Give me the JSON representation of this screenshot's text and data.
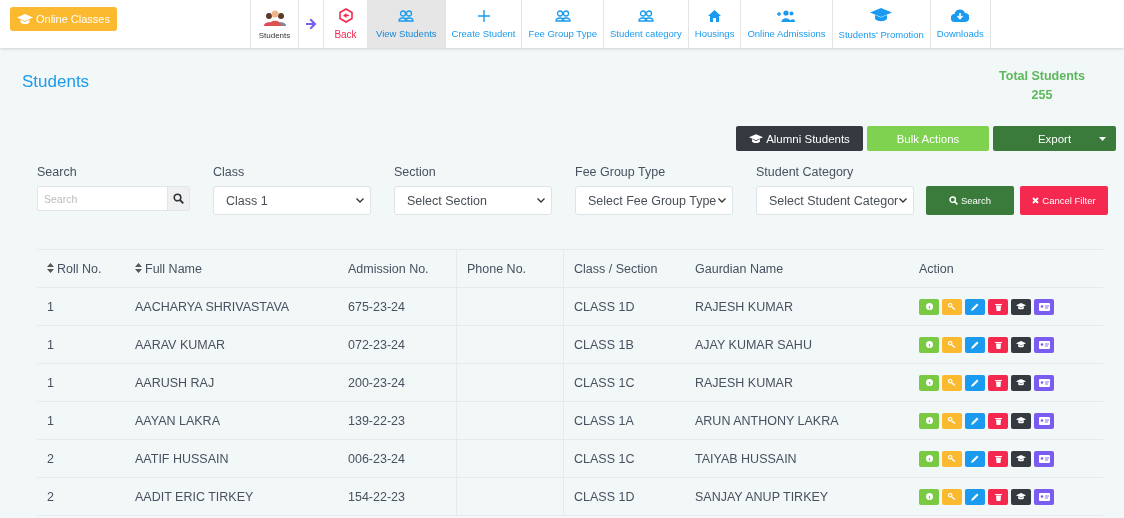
{
  "top_button": {
    "label": "Online Classes"
  },
  "nav": [
    {
      "kind": "module",
      "label": "Students",
      "selected": false
    },
    {
      "kind": "arrow"
    },
    {
      "kind": "back",
      "label": "Back",
      "selected": false
    },
    {
      "kind": "people",
      "label": "View Students",
      "selected": true
    },
    {
      "kind": "plus",
      "label": "Create Student",
      "selected": false
    },
    {
      "kind": "people",
      "label": "Fee Group Type",
      "selected": false
    },
    {
      "kind": "people",
      "label": "Student category",
      "selected": false
    },
    {
      "kind": "home",
      "label": "Housings",
      "selected": false
    },
    {
      "kind": "adduser",
      "label": "Online Admissions",
      "selected": false
    },
    {
      "kind": "cap",
      "label": "Students' Promotion",
      "selected": false
    },
    {
      "kind": "download",
      "label": "Downloads",
      "selected": false
    }
  ],
  "page_title": "Students",
  "total": {
    "label": "Total Students",
    "value": "255"
  },
  "actions": [
    {
      "kind": "alumni",
      "label": "Alumni Students"
    },
    {
      "kind": "bulk",
      "label": "Bulk Actions"
    },
    {
      "kind": "export",
      "label": "Export"
    }
  ],
  "filters": [
    {
      "kind": "search",
      "label": "Search",
      "placeholder": "Search"
    },
    {
      "kind": "select",
      "label": "Class",
      "value": "Class 1"
    },
    {
      "kind": "select",
      "label": "Section",
      "value": "Select Section"
    },
    {
      "kind": "select",
      "label": "Fee Group Type",
      "value": "Select Fee Group Type"
    },
    {
      "kind": "select",
      "label": "Student Category",
      "value": "Select Student Categor"
    }
  ],
  "filter_buttons": [
    {
      "kind": "search",
      "label": "Search"
    },
    {
      "kind": "cancel",
      "label": "Cancel Filter"
    }
  ],
  "table": {
    "columns": [
      {
        "label": "Roll No.",
        "sortable": true
      },
      {
        "label": "Full Name",
        "sortable": true
      },
      {
        "label": "Admission No.",
        "sortable": false
      },
      {
        "label": "Phone No.",
        "sortable": false
      },
      {
        "label": "Class / Section",
        "sortable": false
      },
      {
        "label": "Gaurdian Name",
        "sortable": false
      },
      {
        "label": "Action",
        "sortable": false
      }
    ],
    "row_actions": [
      {
        "kind": "info",
        "color": "#7ac943"
      },
      {
        "kind": "key",
        "color": "#fbb92f"
      },
      {
        "kind": "edit",
        "color": "#1a9bef"
      },
      {
        "kind": "delete",
        "color": "#f5284f"
      },
      {
        "kind": "graduate",
        "color": "#343a40"
      },
      {
        "kind": "card",
        "color": "#7b5cf0"
      }
    ],
    "rows": [
      {
        "roll": "1",
        "name": "AACHARYA SHRIVASTAVA",
        "admission": "675-23-24",
        "class": "CLASS 1D",
        "guardian": "RAJESH KUMAR"
      },
      {
        "roll": "1",
        "name": "AARAV KUMAR",
        "admission": "072-23-24",
        "class": "CLASS 1B",
        "guardian": "AJAY KUMAR SAHU"
      },
      {
        "roll": "1",
        "name": "AARUSH RAJ",
        "admission": "200-23-24",
        "class": "CLASS 1C",
        "guardian": "RAJESH KUMAR"
      },
      {
        "roll": "1",
        "name": "AAYAN LAKRA",
        "admission": "139-22-23",
        "class": "CLASS 1A",
        "guardian": "ARUN ANTHONY LAKRA"
      },
      {
        "roll": "2",
        "name": "AATIF HUSSAIN",
        "admission": "006-23-24",
        "class": "CLASS 1C",
        "guardian": "TAIYAB HUSSAIN"
      },
      {
        "roll": "2",
        "name": "AADIT ERIC TIRKEY",
        "admission": "154-22-23",
        "class": "CLASS 1D",
        "guardian": "SANJAY ANUP TIRKEY"
      }
    ]
  }
}
